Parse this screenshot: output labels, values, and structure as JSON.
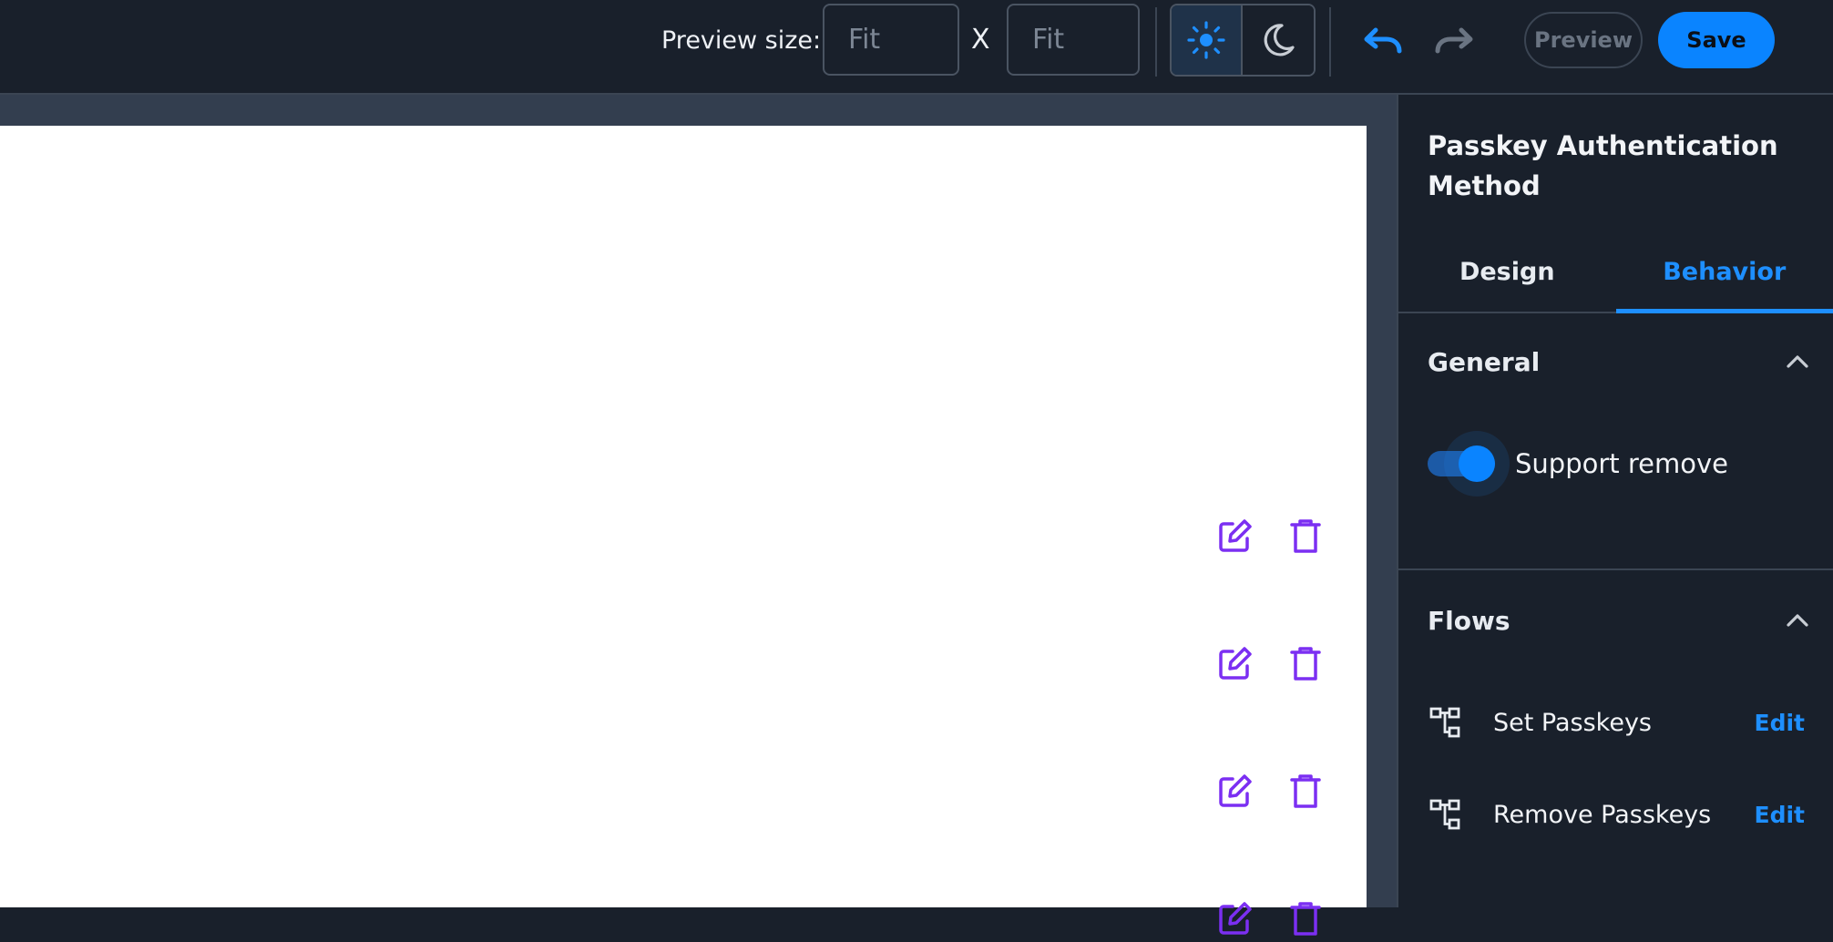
{
  "toolbar": {
    "preview_size_label": "Preview size:",
    "width_placeholder": "Fit",
    "height_placeholder": "Fit",
    "size_separator": "X",
    "preview_label": "Preview",
    "save_label": "Save",
    "icons": {
      "light_theme": "sun-icon",
      "dark_theme": "moon-icon",
      "undo": "undo-icon",
      "redo": "redo-icon"
    },
    "colors": {
      "accent": "#0a84ff",
      "disabled": "#6a7482"
    }
  },
  "canvas": {
    "row_actions": [
      {
        "edit_icon": "edit-icon",
        "delete_icon": "trash-icon"
      },
      {
        "edit_icon": "edit-icon",
        "delete_icon": "trash-icon"
      },
      {
        "edit_icon": "edit-icon",
        "delete_icon": "trash-icon"
      },
      {
        "edit_icon": "edit-icon",
        "delete_icon": "trash-icon"
      }
    ],
    "icon_color": "#7b2ff2"
  },
  "panel": {
    "title": "Passkey Authentication Method",
    "tabs": [
      {
        "label": "Design",
        "active": false
      },
      {
        "label": "Behavior",
        "active": true
      }
    ],
    "general": {
      "label": "General",
      "support_remove": {
        "label": "Support remove",
        "enabled": true
      }
    },
    "flows": {
      "label": "Flows",
      "items": [
        {
          "name": "Set Passkeys",
          "action": "Edit",
          "icon": "flow-icon"
        },
        {
          "name": "Remove Passkeys",
          "action": "Edit",
          "icon": "flow-icon"
        }
      ]
    }
  }
}
